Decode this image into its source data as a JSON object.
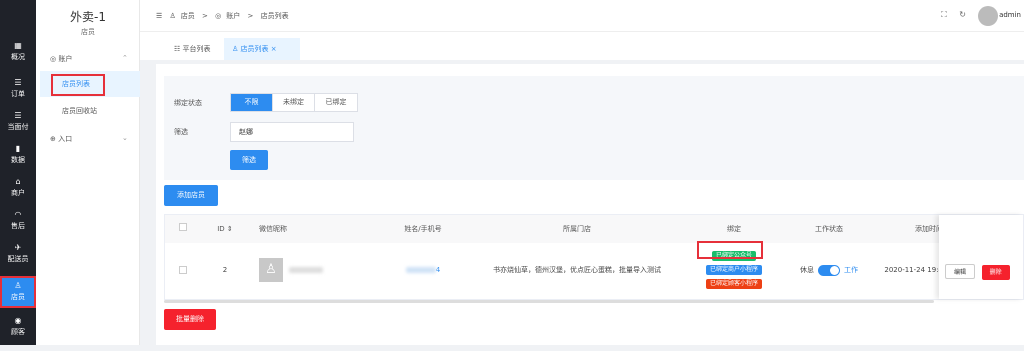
{
  "nav": {
    "items": [
      {
        "label": "概况",
        "icon": "dashboard-icon",
        "glyph": "▦"
      },
      {
        "label": "订单",
        "icon": "order-list-icon",
        "glyph": "☰"
      },
      {
        "label": "当面付",
        "icon": "pay-icon",
        "glyph": "☰"
      },
      {
        "label": "数据",
        "icon": "bar-chart-icon",
        "glyph": "▮"
      },
      {
        "label": "商户",
        "icon": "store-icon",
        "glyph": "⌂"
      },
      {
        "label": "售后",
        "icon": "headset-icon",
        "glyph": "◠"
      },
      {
        "label": "配送员",
        "icon": "delivery-icon",
        "glyph": "✈"
      },
      {
        "label": "店员",
        "icon": "user-icon",
        "glyph": "♙"
      },
      {
        "label": "顾客",
        "icon": "customer-icon",
        "glyph": "◉"
      }
    ]
  },
  "sidebar": {
    "title": "外卖-1",
    "subtitle": "店员",
    "group_account": "账户",
    "item_list": "店员列表",
    "item_recycle": "店员回收站",
    "group_entry": "入口"
  },
  "header": {
    "breadcrumb": [
      "店员",
      ">",
      "账户",
      ">",
      "店员列表"
    ],
    "username": "admin"
  },
  "tabs": [
    {
      "label": "平台列表"
    },
    {
      "label": "店员列表",
      "close": "×"
    }
  ],
  "filter": {
    "bind_label": "绑定状态",
    "options": [
      "不限",
      "未绑定",
      "已绑定"
    ],
    "selected": "不限",
    "search_label": "筛选",
    "search_value": "赵娜",
    "search_button": "筛选"
  },
  "add_button": "添加店员",
  "table": {
    "columns": [
      "ID",
      "微信昵称",
      "姓名/手机号",
      "所属门店",
      "绑定",
      "工作状态",
      "添加时间",
      "操作"
    ],
    "sort_icon": "⇕",
    "rows": [
      {
        "id": "2",
        "phone_tail": "4",
        "store": "书亦烧仙草，德州汉堡，优点匠心蛋糕，批量导入测试",
        "tags": [
          {
            "label": "已绑定公众号",
            "color": "#19be6b"
          },
          {
            "label": "已绑定商户小程序",
            "color": "#2d8cf0"
          },
          {
            "label": "已绑定顾客小程序",
            "color": "#ed4014"
          }
        ],
        "status_off": "休息",
        "status_on": "工作",
        "added": "2020-11-24 19:4",
        "edit": "编辑",
        "delete": "删除"
      }
    ]
  },
  "batch_delete": "批量删除",
  "colors": {
    "primary": "#2d8cf0",
    "danger": "#f5222d",
    "highlight": "#e6303a"
  }
}
